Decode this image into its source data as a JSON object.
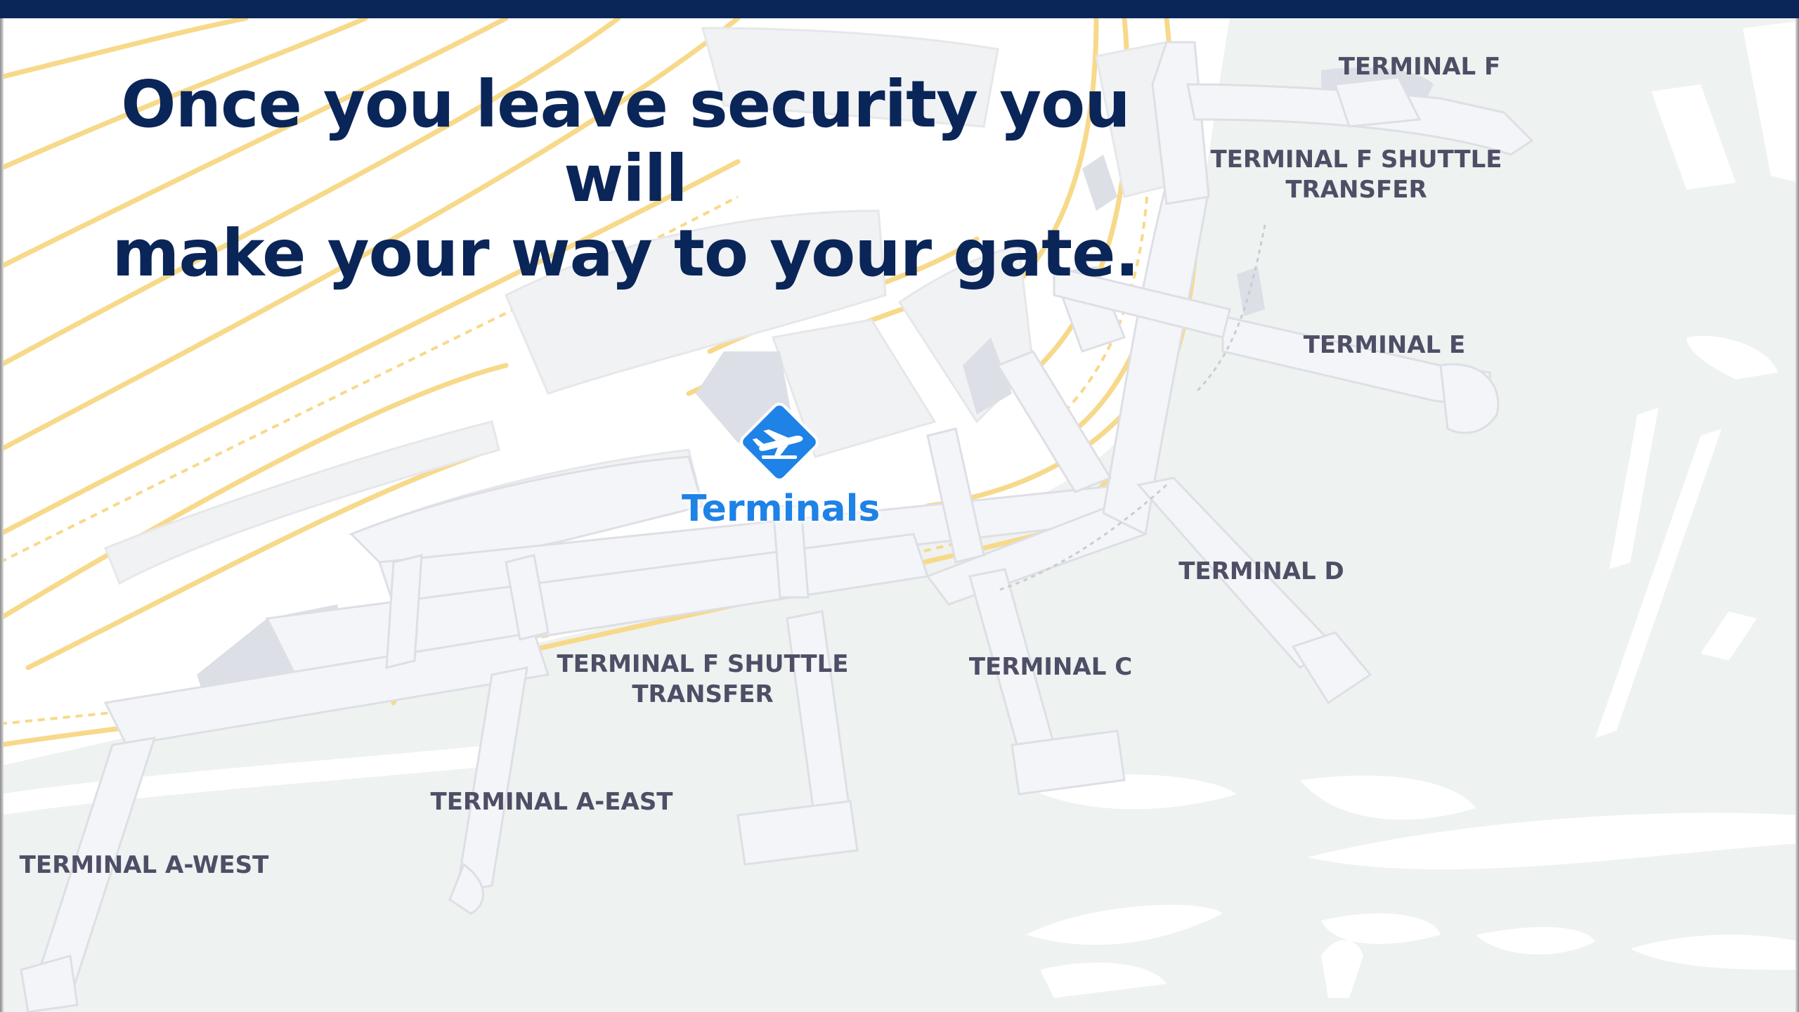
{
  "slide": {
    "headline_line1": "Once you leave security you will",
    "headline_line2": "make your way to your gate."
  },
  "map": {
    "center_marker": {
      "label": "Terminals",
      "icon": "airplane-departure-icon",
      "color": "#1e82e6"
    },
    "terminals": {
      "f": "TERMINAL F",
      "f_shuttle_north": "TERMINAL F  SHUTTLE\nTRANSFER",
      "e": "TERMINAL E",
      "d": "TERMINAL D",
      "c": "TERMINAL C",
      "f_shuttle_south": "TERMINAL F  SHUTTLE\nTRANSFER",
      "a_east": "TERMINAL A-EAST",
      "a_west": "TERMINAL A-WEST"
    },
    "colors": {
      "header_bar": "#0a2558",
      "headline": "#0a2558",
      "road": "#f7d98a",
      "ground": "#eef2f0",
      "building": "#f4f5f8",
      "label": "#4e4e66"
    }
  }
}
